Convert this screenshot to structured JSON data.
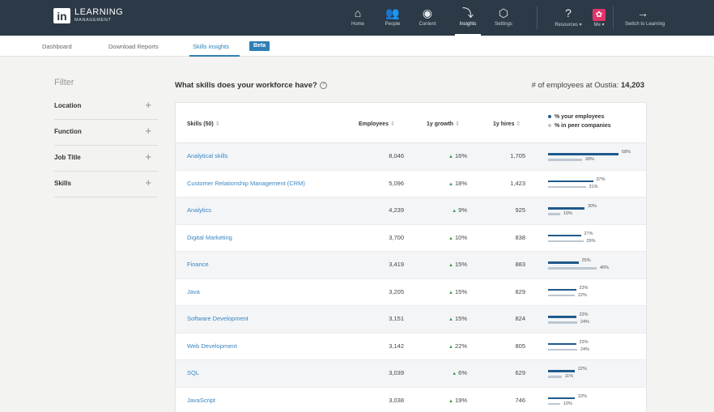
{
  "app": {
    "logo_letters": "in",
    "title_line1": "LEARNING",
    "title_line2": "MANAGEMENT"
  },
  "nav": [
    {
      "label": "Home",
      "icon": "home-icon",
      "glyph": "⌂"
    },
    {
      "label": "People",
      "icon": "people-icon",
      "glyph": "👥"
    },
    {
      "label": "Content",
      "icon": "content-icon",
      "glyph": "◉"
    },
    {
      "label": "Insights",
      "icon": "insights-icon",
      "glyph": "⤵",
      "active": true
    },
    {
      "label": "Settings",
      "icon": "settings-icon",
      "glyph": "⬡"
    },
    {
      "label": "Resources ▾",
      "icon": "resources-icon",
      "glyph": "?"
    },
    {
      "label": "Me ▾",
      "icon": "avatar",
      "glyph": "✿"
    },
    {
      "label": "Switch to Learning",
      "icon": "switch-arrow-icon",
      "glyph": "→"
    }
  ],
  "subnav": {
    "tabs": [
      "Dashboard",
      "Download Reports",
      "Skills insights"
    ],
    "active": "Skills insights",
    "badge": "Beta"
  },
  "filter": {
    "title": "Filter",
    "items": [
      "Location",
      "Function",
      "Job Title",
      "Skills"
    ]
  },
  "header": {
    "question": "What skills does your workforce have?",
    "employees_label": "# of employees at Oustia:",
    "employees_value": "14,203"
  },
  "table": {
    "columns": [
      "Skills (50)",
      "Employees",
      "1y growth",
      "1y hires"
    ],
    "legend": [
      "% your employees",
      "% in peer companies"
    ],
    "rows": [
      {
        "skill": "Analytical skills",
        "employees": "8,046",
        "growth": "16%",
        "hires": "1,705",
        "you": 58,
        "peer": 28
      },
      {
        "skill": "Customer Relationship Management (CRM)",
        "employees": "5,096",
        "growth": "18%",
        "hires": "1,423",
        "you": 37,
        "peer": 31
      },
      {
        "skill": "Analytics",
        "employees": "4,239",
        "growth": "9%",
        "hires": "925",
        "you": 30,
        "peer": 10
      },
      {
        "skill": "Digital Marketing",
        "employees": "3,700",
        "growth": "10%",
        "hires": "838",
        "you": 27,
        "peer": 29
      },
      {
        "skill": "Finance",
        "employees": "3,419",
        "growth": "15%",
        "hires": "883",
        "you": 25,
        "peer": 40
      },
      {
        "skill": "Java",
        "employees": "3,205",
        "growth": "15%",
        "hires": "829",
        "you": 23,
        "peer": 22
      },
      {
        "skill": "Software Development",
        "employees": "3,151",
        "growth": "15%",
        "hires": "824",
        "you": 23,
        "peer": 24
      },
      {
        "skill": "Web Development",
        "employees": "3,142",
        "growth": "22%",
        "hires": "805",
        "you": 23,
        "peer": 24
      },
      {
        "skill": "SQL",
        "employees": "3,039",
        "growth": "6%",
        "hires": "629",
        "you": 22,
        "peer": 11
      },
      {
        "skill": "JavaScript",
        "employees": "3,038",
        "growth": "19%",
        "hires": "746",
        "you": 22,
        "peer": 10
      }
    ]
  },
  "colors": {
    "topbar": "#2c3a47",
    "link": "#3a86c2",
    "bar_you": "#1f5a8c",
    "bar_peer": "#bcc7d1",
    "growth_up": "#3a9a4f"
  }
}
